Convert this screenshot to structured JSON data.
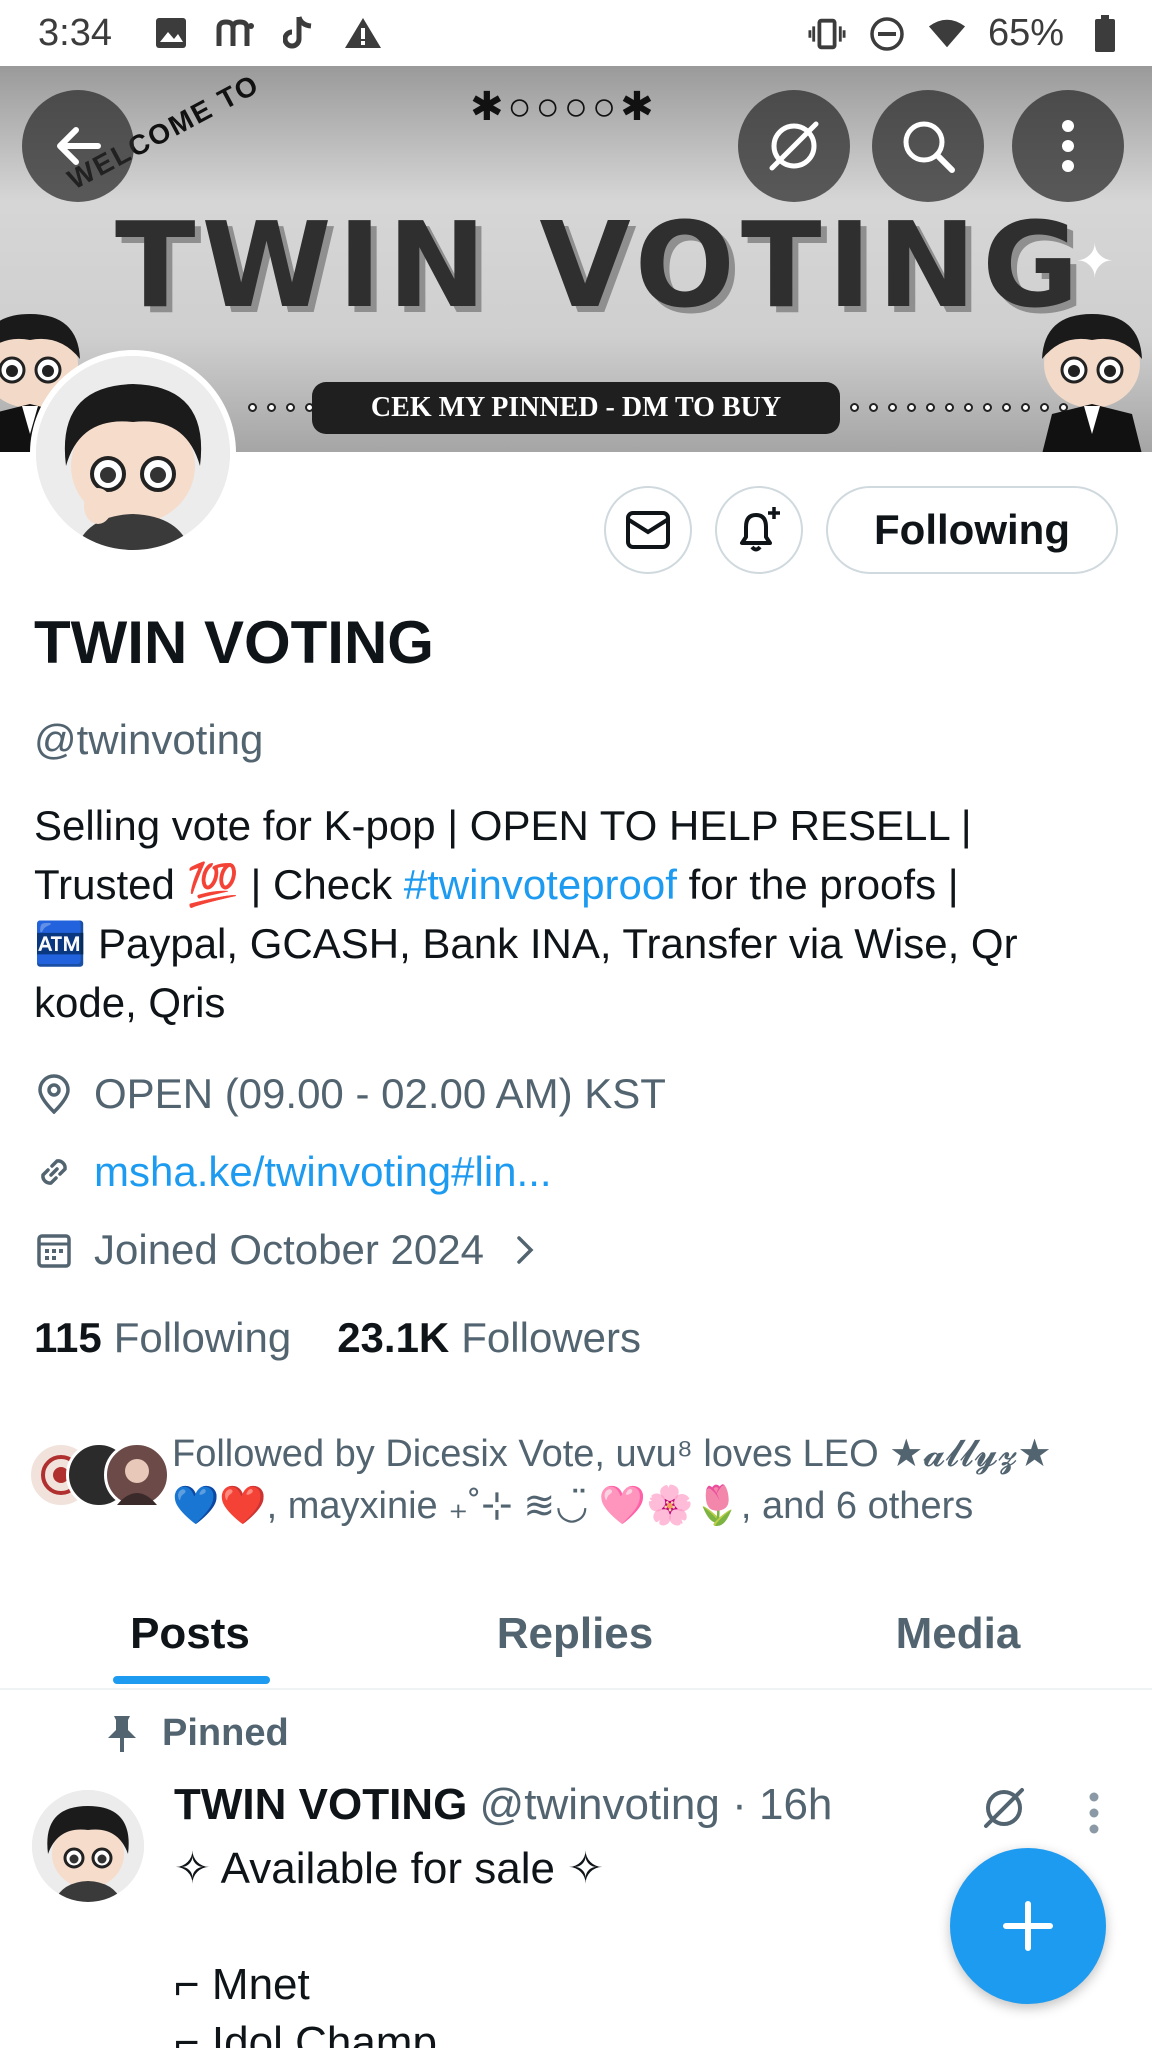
{
  "status_bar": {
    "time": "3:34",
    "battery": "65%",
    "left_icons": [
      "image-icon",
      "m-app-icon",
      "tiktok-icon",
      "warning-icon"
    ],
    "right_icons": [
      "vibrate-icon",
      "dnd-icon",
      "wifi-icon",
      "battery-icon"
    ]
  },
  "banner": {
    "decoration": "✱○○○○✱",
    "welcome": "WELCOME TO",
    "title": "TWIN VOTING",
    "pill": "CEK MY PINNED - DM TO BUY",
    "sparkle": "✦"
  },
  "top_nav": {
    "back_icon": "arrow-left-icon",
    "grok_icon": "grok-icon",
    "search_icon": "search-icon",
    "more_icon": "more-vertical-icon"
  },
  "profile": {
    "display_name": "TWIN VOTING",
    "handle": "@twinvoting",
    "bio": {
      "line1": "Selling vote for K-pop | OPEN TO HELP RESELL |",
      "line2_pre": "Trusted 💯 | Check ",
      "line2_link": "#twinvoteproof",
      "line2_post": " for the proofs |",
      "line3": "🏧 Paypal,  GCASH, Bank INA, Transfer via Wise, Qr",
      "line4": "kode, Qris"
    },
    "location": "OPEN (09.00  - 02.00 AM) KST",
    "website": "msha.ke/twinvoting#lin...",
    "joined": "Joined October 2024",
    "following_count": "115",
    "following_label": "Following",
    "followers_count": "23.1K",
    "followers_label": "Followers",
    "followed_by_line1": "Followed by Dicesix Vote, uvu⁸ loves LEO ★𝓪𝓵𝓵𝔂𝔃★",
    "followed_by_line2": "💙❤️, mayxinie ₊˚⊹ ≋◡̈ 🩷🌸🌷, and 6 others"
  },
  "actions": {
    "message_icon": "mail-icon",
    "notify_icon": "bell-plus-icon",
    "follow_button": "Following"
  },
  "tabs": [
    {
      "label": "Posts",
      "active": true
    },
    {
      "label": "Replies",
      "active": false
    },
    {
      "label": "Media",
      "active": false
    }
  ],
  "pinned_post": {
    "pinned_label": "Pinned",
    "author_name": "TWIN VOTING",
    "author_meta": "@twinvoting · 16h",
    "body": "✧ Available for sale ✧\n\n⌐ Mnet\n⌐ Idol Champ"
  },
  "fab": {
    "icon": "plus-icon"
  },
  "colors": {
    "accent": "#1d9bf0",
    "text_primary": "#0f1419",
    "text_secondary": "#536471",
    "border": "#cfd9de"
  }
}
